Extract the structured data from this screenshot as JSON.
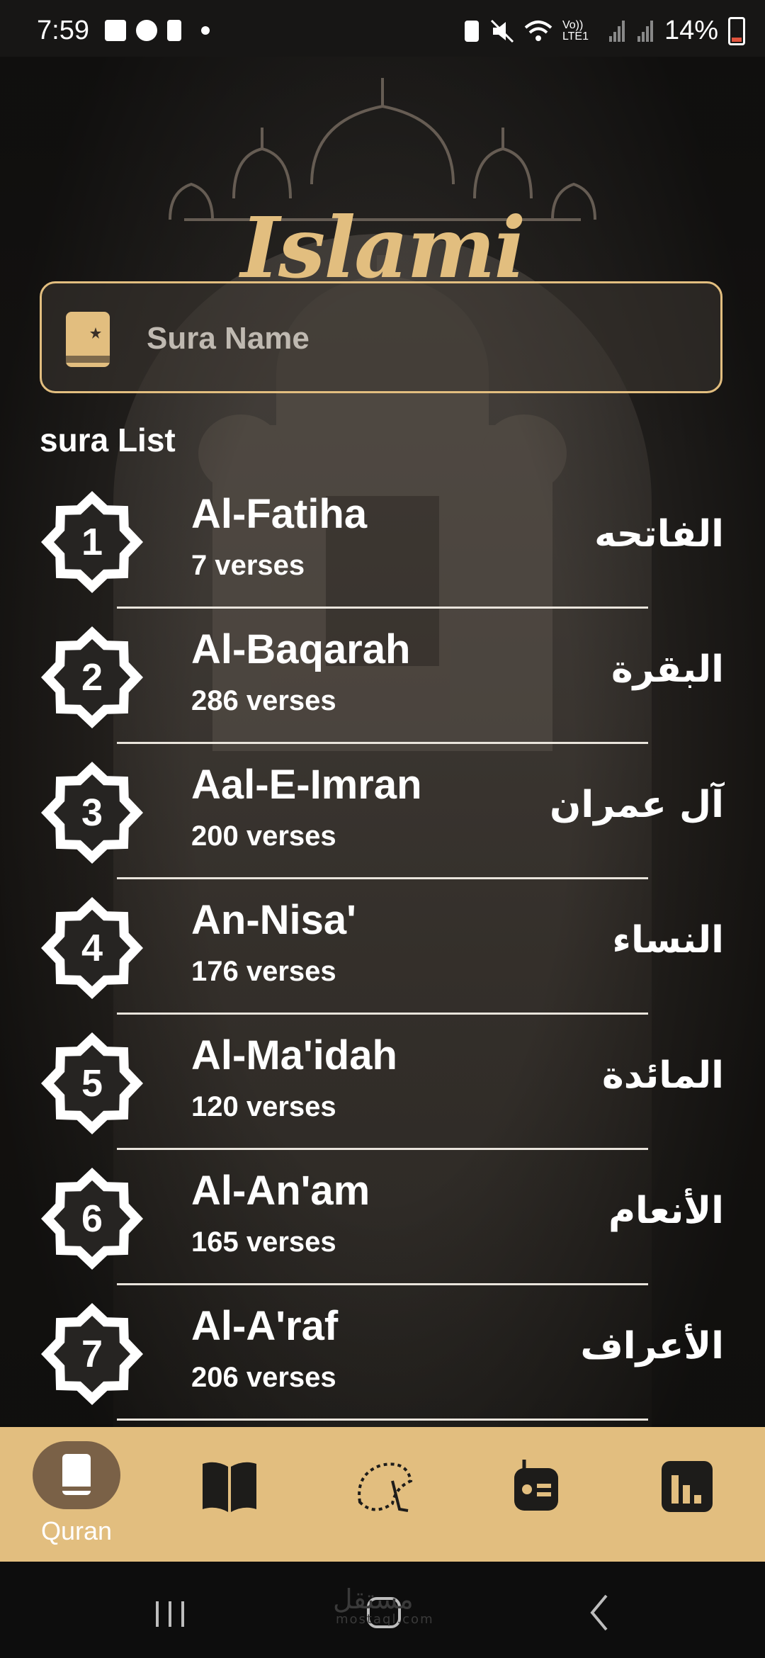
{
  "status_bar": {
    "time": "7:59",
    "network_label": "Vo)) LTE1",
    "battery_percent": "14%"
  },
  "app": {
    "logo_text": "Islami",
    "accent_color": "#e2be7f"
  },
  "search": {
    "placeholder": "Sura Name",
    "value": ""
  },
  "section_title": "sura List",
  "suras": [
    {
      "number": "1",
      "name": "Al-Fatiha",
      "verses": "7 verses",
      "arabic": "الفاتحه"
    },
    {
      "number": "2",
      "name": "Al-Baqarah",
      "verses": "286 verses",
      "arabic": "البقرة"
    },
    {
      "number": "3",
      "name": "Aal-E-Imran",
      "verses": "200 verses",
      "arabic": "آل عمران"
    },
    {
      "number": "4",
      "name": "An-Nisa'",
      "verses": "176 verses",
      "arabic": "النساء"
    },
    {
      "number": "5",
      "name": "Al-Ma'idah",
      "verses": "120 verses",
      "arabic": "المائدة"
    },
    {
      "number": "6",
      "name": "Al-An'am",
      "verses": "165 verses",
      "arabic": "الأنعام"
    },
    {
      "number": "7",
      "name": "Al-A'raf",
      "verses": "206 verses",
      "arabic": "الأعراف"
    }
  ],
  "bottom_nav": {
    "items": [
      {
        "icon": "quran-icon",
        "label": "Quran",
        "active": true
      },
      {
        "icon": "book-icon",
        "label": "",
        "active": false
      },
      {
        "icon": "sebha-icon",
        "label": "",
        "active": false
      },
      {
        "icon": "radio-icon",
        "label": "",
        "active": false
      },
      {
        "icon": "time-icon",
        "label": "",
        "active": false
      }
    ]
  },
  "watermark": {
    "arabic": "مستقل",
    "latin": "mostaql.com"
  }
}
